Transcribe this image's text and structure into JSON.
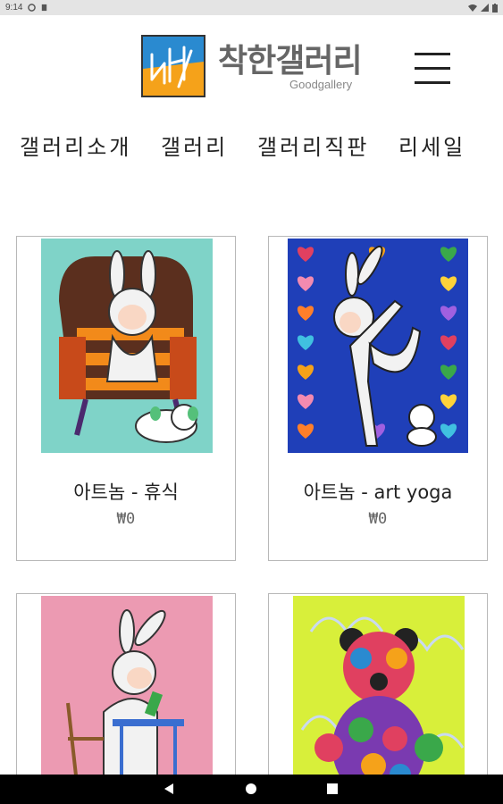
{
  "status_bar": {
    "time": "9:14"
  },
  "header": {
    "title": "착한갤러리",
    "subtitle": "Goodgallery"
  },
  "nav": {
    "items": [
      "갤러리소개",
      "갤러리",
      "갤러리직판",
      "리세일"
    ]
  },
  "cards": [
    {
      "title": "아트놈 - 휴식",
      "price": "₩0"
    },
    {
      "title": "아트놈 - art yoga",
      "price": "₩0"
    },
    {
      "title": "",
      "price": ""
    },
    {
      "title": "",
      "price": ""
    }
  ],
  "colors": {
    "logo_blue": "#2a8ad0",
    "logo_orange": "#f5a21a",
    "nav_bar": "#000000"
  }
}
